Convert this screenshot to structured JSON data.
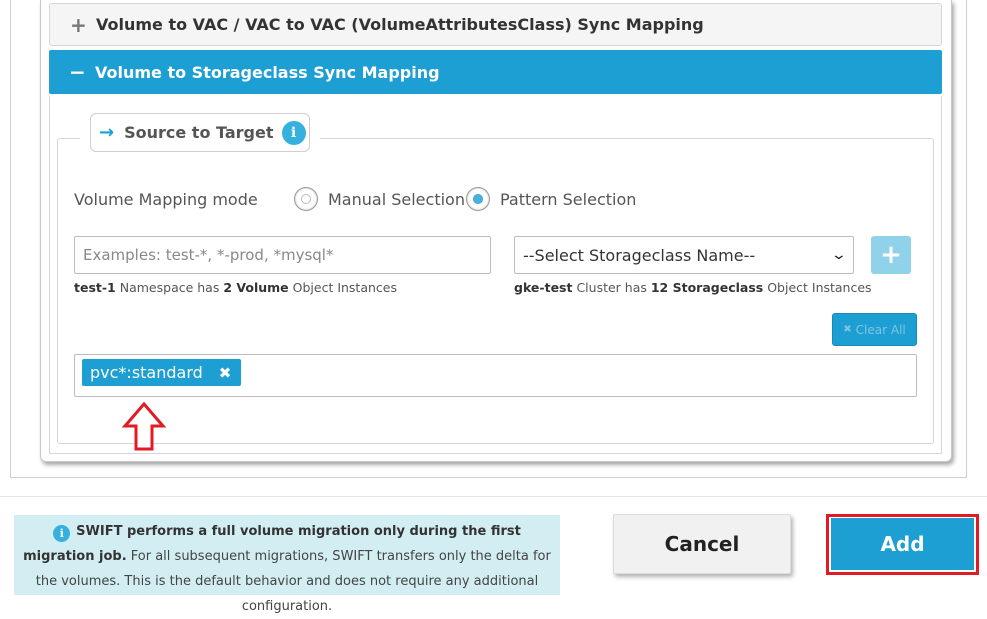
{
  "accordion": {
    "vac_header": {
      "sign": "+",
      "title": "Volume to VAC / VAC to VAC (VolumeAttributesClass) Sync Mapping"
    },
    "sc_header": {
      "sign": "−",
      "title": "Volume to Storageclass Sync Mapping"
    }
  },
  "panel": {
    "legend_title": "Source to Target",
    "legend_arrow_glyph": "→",
    "info_glyph": "i",
    "mode_label": "Volume Mapping mode",
    "mode_options": [
      {
        "label": "Manual Selection",
        "selected": false
      },
      {
        "label": "Pattern Selection",
        "selected": true
      }
    ],
    "pattern_input": {
      "value": "",
      "placeholder": "Examples: test-*, *-prod, *mysql*"
    },
    "storageclass_select": {
      "selected": "--Select Storageclass Name--",
      "chevron_glyph": "⌄"
    },
    "add_glyph": "+",
    "namespace_hint": {
      "namespace": "test-1",
      "text_1": " Namespace has ",
      "count": "2 Volume",
      "text_2": " Object Instances"
    },
    "cluster_hint": {
      "cluster": "gke-test",
      "text_1": " Cluster has ",
      "count": "12 Storageclass",
      "text_2": " Object Instances"
    },
    "clear_all": {
      "icon": "✖",
      "label": "Clear All"
    },
    "mappings": [
      {
        "label": "pvc*:standard",
        "remove_glyph": "✖"
      }
    ]
  },
  "footer": {
    "info_glyph": "i",
    "info_bold": "SWIFT performs a full volume migration only during the first migration job.",
    "info_rest": " For all subsequent migrations, SWIFT transfers only the delta for the volumes. This is the default behavior and does not require any additional configuration.",
    "cancel_label": "Cancel",
    "add_label": "Add"
  },
  "colors": {
    "accent": "#1d9fd3",
    "highlight": "#e01b24",
    "info_bg": "#d3eef2"
  }
}
